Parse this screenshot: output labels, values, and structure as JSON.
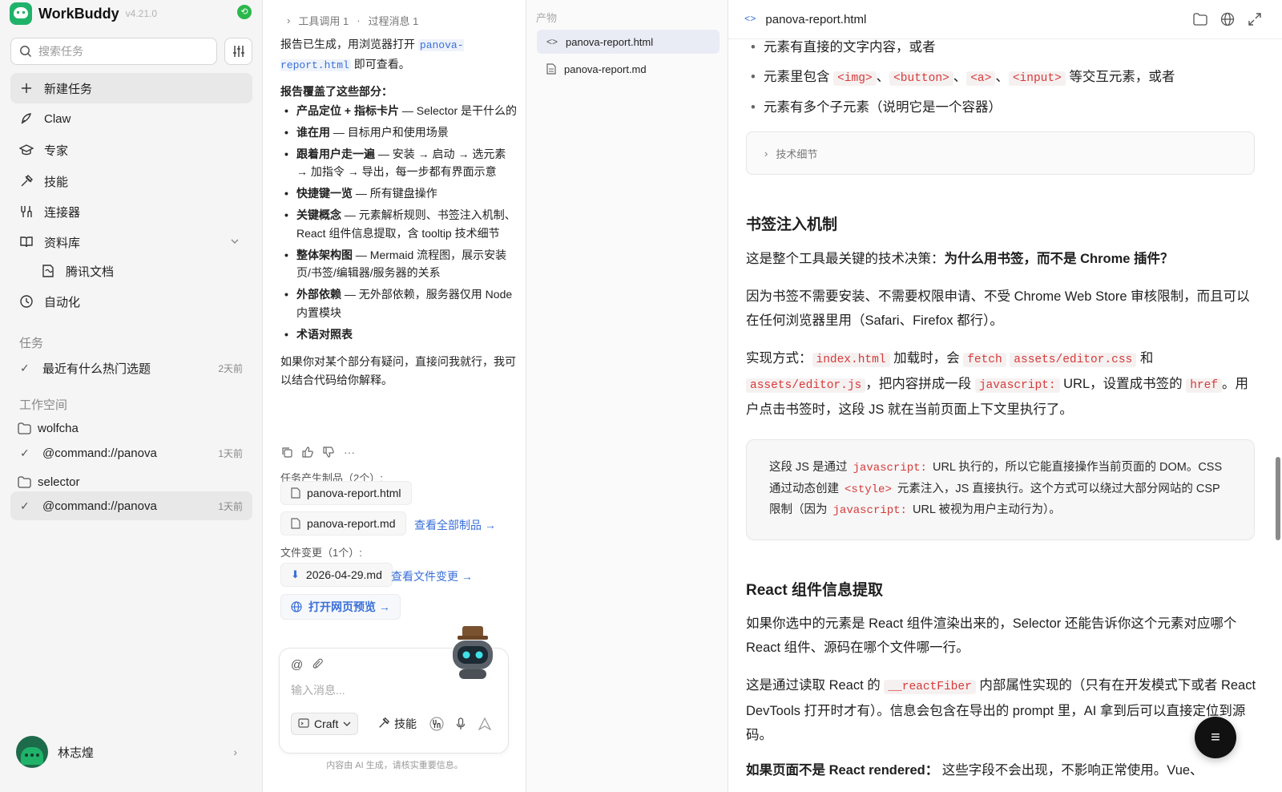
{
  "app": {
    "name": "WorkBuddy",
    "version": "v4.21.0"
  },
  "sidebar": {
    "search_placeholder": "搜索任务",
    "nav": [
      {
        "label": "新建任务",
        "icon": "plus-icon"
      },
      {
        "label": "Claw",
        "icon": "claw-icon"
      },
      {
        "label": "专家",
        "icon": "graduation-cap-icon"
      },
      {
        "label": "技能",
        "icon": "skill-icon"
      },
      {
        "label": "连接器",
        "icon": "connector-icon"
      },
      {
        "label": "资料库",
        "icon": "book-icon"
      },
      {
        "label": "腾讯文档",
        "icon": "doc-icon"
      },
      {
        "label": "自动化",
        "icon": "clock-icon"
      }
    ],
    "tasks_label": "任务",
    "tasks": [
      {
        "title": "最近有什么热门选题",
        "time": "2天前"
      }
    ],
    "workspace_label": "工作空间",
    "workspaces": [
      {
        "name": "wolfcha",
        "tasks": [
          {
            "title": "@command://panova",
            "time": "1天前"
          }
        ]
      },
      {
        "name": "selector",
        "tasks": [
          {
            "title": "@command://panova",
            "time": "1天前"
          }
        ]
      }
    ],
    "user": {
      "name": "林志煌"
    }
  },
  "chat": {
    "top": {
      "tool_calls": "工具调用 1",
      "process_msgs": "过程消息 1"
    },
    "intro_pre": "报告已生成，用浏览器打开 ",
    "intro_code": "panova-report.html",
    "intro_post": " 即可查看。",
    "sections_title": "报告覆盖了这些部分：",
    "sections": [
      {
        "title": "产品定位 + 指标卡片",
        "desc": " — Selector 是干什么的"
      },
      {
        "title": "谁在用",
        "desc": " — 目标用户和使用场景"
      },
      {
        "title": "跟着用户走一遍",
        "desc": " — 安装 → 启动 → 选元素 → 加指令 → 导出，每一步都有界面示意"
      },
      {
        "title": "快捷键一览",
        "desc": " — 所有键盘操作"
      },
      {
        "title": "关键概念",
        "desc": " — 元素解析规则、书签注入机制、React 组件信息提取，含 tooltip 技术细节"
      },
      {
        "title": "整体架构图",
        "desc": " — Mermaid 流程图，展示安装页/书签/编辑器/服务器的关系"
      },
      {
        "title": "外部依赖",
        "desc": " — 无外部依赖，服务器仅用 Node 内置模块"
      },
      {
        "title": "术语对照表",
        "desc": ""
      }
    ],
    "closing": "如果你对某个部分有疑问，直接问我就行，我可以结合代码给你解释。",
    "artifacts_label": "任务产生制品（2个）:",
    "artifacts": [
      "panova-report.html",
      "panova-report.md"
    ],
    "view_all": "查看全部制品 →",
    "file_changes_label": "文件变更（1个）:",
    "file_change": "2026-04-29.md",
    "view_changes": "查看文件变更 →",
    "open_preview": "打开网页预览 →",
    "input_placeholder": "输入消息...",
    "mode_label": "Craft",
    "skill_label": "技能",
    "disclaimer": "内容由 AI 生成，请核实重要信息。"
  },
  "artifacts_panel": {
    "title": "产物",
    "items": [
      {
        "name": "panova-report.html",
        "icon": "code-icon",
        "active": true
      },
      {
        "name": "panova-report.md",
        "icon": "file-icon",
        "active": false
      }
    ]
  },
  "preview": {
    "title": "panova-report.html",
    "bullet1": "元素有直接的文字内容，或者",
    "bullet2_pre": "元素里包含 ",
    "bullet2_tags": [
      "<img>",
      "<button>",
      "<a>",
      "<input>"
    ],
    "bullet2_sep": "、",
    "bullet2_post": " 等交互元素，或者",
    "bullet3": "元素有多个子元素（说明它是一个容器）",
    "details_label": "技术细节",
    "h_bookmark": "书签注入机制",
    "p1_pre": "这是整个工具最关键的技术决策：",
    "p1_bold": "为什么用书签，而不是 Chrome 插件？",
    "p2": "因为书签不需要安装、不需要权限申请、不受 Chrome Web Store 审核限制，而且可以在任何浏览器里用（Safari、Firefox 都行）。",
    "p3": {
      "a": "实现方式：",
      "c1": "index.html",
      "b": " 加载时，会 ",
      "c2": "fetch",
      "c3": "assets/editor.css",
      "d": " 和 ",
      "c4": "assets/editor.js",
      "e": "，把内容拼成一段 ",
      "c5": "javascript:",
      "f": " URL，设置成书签的 ",
      "c6": "href",
      "g": "。用户点击书签时，这段 JS 就在当前页面上下文里执行了。"
    },
    "callout": {
      "a": "这段 JS 是通过 ",
      "c1": "javascript:",
      "b": " URL 执行的，所以它能直接操作当前页面的 DOM。CSS 通过动态创建 ",
      "c2": "<style>",
      "c": " 元素注入，JS 直接执行。这个方式可以绕过大部分网站的 CSP 限制（因为 ",
      "c3": "javascript:",
      "d": " URL 被视为用户主动行为）。"
    },
    "h_react": "React 组件信息提取",
    "p4": "如果你选中的元素是 React 组件渲染出来的，Selector 还能告诉你这个元素对应哪个 React 组件、源码在哪个文件哪一行。",
    "p5": {
      "a": "这是通过读取 React 的 ",
      "c1": "__reactFiber",
      "b": " 内部属性实现的（只有在开发模式下或者 React DevTools 打开时才有）。信息会包含在导出的 prompt 里，AI 拿到后可以直接定位到源码。"
    },
    "p6_bold": "如果页面不是 React rendered：",
    "p6_rest": " 这些字段不会出现，不影响正常使用。Vue、"
  }
}
